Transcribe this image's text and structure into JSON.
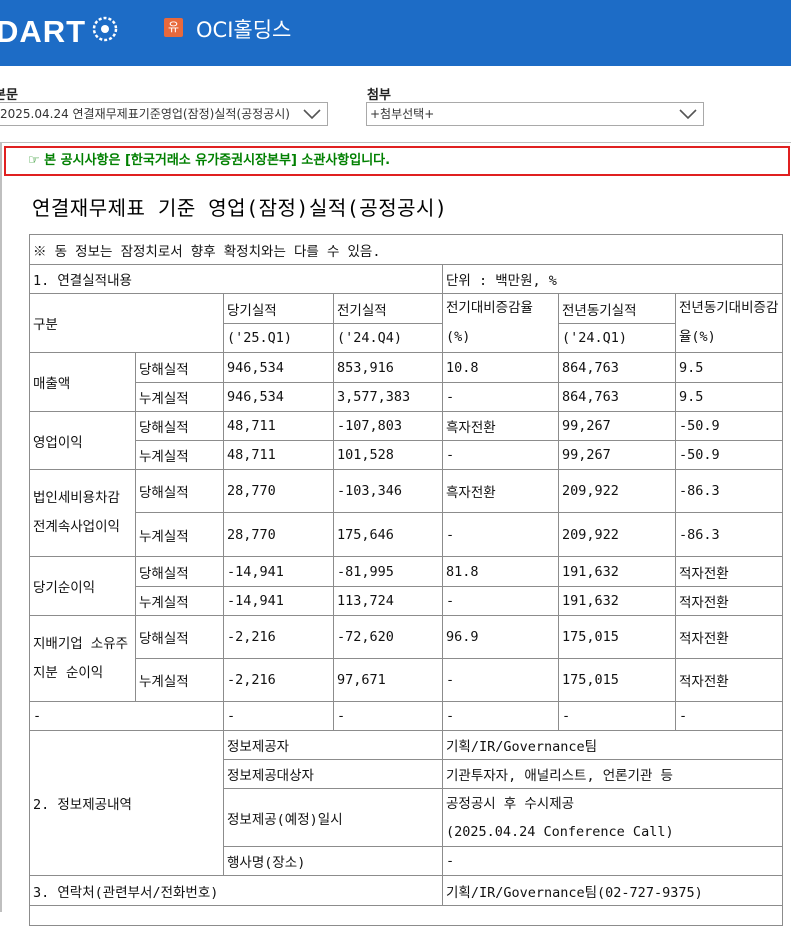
{
  "header": {
    "logo": "DART",
    "company_badge": "유",
    "company_name": "OCI홀딩스",
    "brand_color": "#1d6cc6"
  },
  "toolbar": {
    "body_label": "본문",
    "body_select": "2025.04.24  연결재무제표기준영업(잠정)실적(공정공시)",
    "attach_label": "첨부",
    "attach_select": "+첨부선택+"
  },
  "notice": "☞ 본 공시사항은 [한국거래소 유가증권시장본부] 소관사항입니다.",
  "doc_title": "연결재무제표 기준 영업(잠정)실적(공정공시)",
  "table": {
    "disclaimer": "※ 동 정보는 잠정치로서 향후 확정치와는 다를 수 있음.",
    "section1": "1. 연결실적내용",
    "unit": "단위 : 백만원, %",
    "col_category": "구분",
    "col_current": "당기실적",
    "col_current_period": "('25.Q1)",
    "col_prev": "전기실적",
    "col_prev_period": "('24.Q4)",
    "col_prev_change": "전기대비증감율(%)",
    "col_yoy": "전년동기실적",
    "col_yoy_period": "('24.Q1)",
    "col_yoy_change": "전년동기대비증감율(%)",
    "rows": [
      {
        "item": "매출액",
        "q": {
          "type": "당해실적",
          "cur": "946,534",
          "prev": "853,916",
          "pchg": "10.8",
          "yoy": "864,763",
          "ychg": "9.5"
        },
        "c": {
          "type": "누계실적",
          "cur": "946,534",
          "prev": "3,577,383",
          "pchg": "-",
          "yoy": "864,763",
          "ychg": "9.5"
        }
      },
      {
        "item": "영업이익",
        "q": {
          "type": "당해실적",
          "cur": "48,711",
          "prev": "-107,803",
          "pchg": "흑자전환",
          "yoy": "99,267",
          "ychg": "-50.9"
        },
        "c": {
          "type": "누계실적",
          "cur": "48,711",
          "prev": "101,528",
          "pchg": "-",
          "yoy": "99,267",
          "ychg": "-50.9"
        }
      },
      {
        "item": "법인세비용차감전계속사업이익",
        "q": {
          "type": "당해실적",
          "cur": "28,770",
          "prev": "-103,346",
          "pchg": "흑자전환",
          "yoy": "209,922",
          "ychg": "-86.3"
        },
        "c": {
          "type": "누계실적",
          "cur": "28,770",
          "prev": "175,646",
          "pchg": "-",
          "yoy": "209,922",
          "ychg": "-86.3"
        }
      },
      {
        "item": "당기순이익",
        "q": {
          "type": "당해실적",
          "cur": "-14,941",
          "prev": "-81,995",
          "pchg": "81.8",
          "yoy": "191,632",
          "ychg": "적자전환"
        },
        "c": {
          "type": "누계실적",
          "cur": "-14,941",
          "prev": "113,724",
          "pchg": "-",
          "yoy": "191,632",
          "ychg": "적자전환"
        }
      },
      {
        "item": "지배기업 소유주지분 순이익",
        "q": {
          "type": "당해실적",
          "cur": "-2,216",
          "prev": "-72,620",
          "pchg": "96.9",
          "yoy": "175,015",
          "ychg": "적자전환"
        },
        "c": {
          "type": "누계실적",
          "cur": "-2,216",
          "prev": "97,671",
          "pchg": "-",
          "yoy": "175,015",
          "ychg": "적자전환"
        }
      }
    ],
    "dash": "-",
    "section2": "2. 정보제공내역",
    "info_provider_label": "정보제공자",
    "info_provider": "기획/IR/Governance팀",
    "info_target_label": "정보제공대상자",
    "info_target": "기관투자자, 애널리스트, 언론기관 등",
    "info_date_label": "정보제공(예정)일시",
    "info_date_line1": "공정공시 후 수시제공",
    "info_date_line2": "(2025.04.24 Conference Call)",
    "event_label": "행사명(장소)",
    "event_value": "-",
    "section3": "3. 연락처(관련부서/전화번호)",
    "contact": "기획/IR/Governance팀(02-727-9375)"
  }
}
